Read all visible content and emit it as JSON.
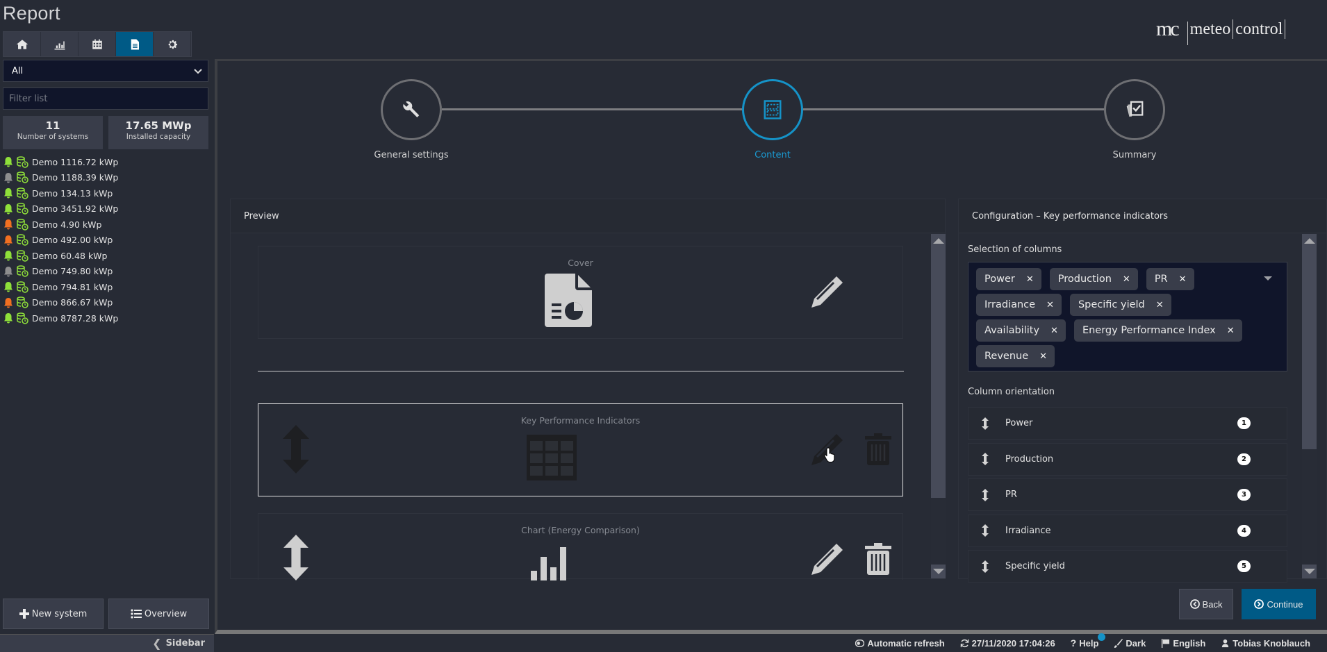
{
  "app": {
    "title": "Report"
  },
  "logo": {
    "mark": "mc",
    "word1": "meteo",
    "word2": "control"
  },
  "nav_tabs": [
    {
      "name": "home",
      "icon": "home-icon",
      "active": false
    },
    {
      "name": "analysis",
      "icon": "bar-chart-icon",
      "active": false
    },
    {
      "name": "calendar",
      "icon": "calendar-icon",
      "active": false
    },
    {
      "name": "report",
      "icon": "document-icon",
      "active": true
    },
    {
      "name": "settings",
      "icon": "gear-icon",
      "active": false
    }
  ],
  "sidebar": {
    "group_select": {
      "value": "All"
    },
    "filter": {
      "placeholder": "Filter list",
      "value": ""
    },
    "stats": [
      {
        "value": "11",
        "label": "Number of systems"
      },
      {
        "value": "17.65 MWp",
        "label": "Installed capacity"
      }
    ],
    "systems": [
      {
        "name": "Demo 1116.72 kWp",
        "alarm": "green"
      },
      {
        "name": "Demo 1188.39 kWp",
        "alarm": "gray"
      },
      {
        "name": "Demo 134.13 kWp",
        "alarm": "green"
      },
      {
        "name": "Demo 3451.92 kWp",
        "alarm": "green"
      },
      {
        "name": "Demo 4.90 kWp",
        "alarm": "orange"
      },
      {
        "name": "Demo 492.00 kWp",
        "alarm": "orange"
      },
      {
        "name": "Demo 60.48 kWp",
        "alarm": "green"
      },
      {
        "name": "Demo 749.80 kWp",
        "alarm": "gray"
      },
      {
        "name": "Demo 794.81 kWp",
        "alarm": "green"
      },
      {
        "name": "Demo 866.67 kWp",
        "alarm": "orange"
      },
      {
        "name": "Demo 8787.28 kWp",
        "alarm": "green"
      }
    ],
    "new_system_label": "New system",
    "overview_label": "Overview",
    "toggle_label": "Sidebar"
  },
  "colors": {
    "accent": "#1593c8",
    "primary_button": "#005a86",
    "alarm_green": "#8fe03a",
    "alarm_orange": "#f26f21",
    "alarm_gray": "#8e8e8e",
    "db_icon": "#8fe03a"
  },
  "wizard": {
    "steps": [
      {
        "label": "General settings",
        "icon": "wrench-icon",
        "state": "done"
      },
      {
        "label": "Content",
        "icon": "layout-icon",
        "state": "active"
      },
      {
        "label": "Summary",
        "icon": "checklist-icon",
        "state": "pending"
      }
    ]
  },
  "preview": {
    "title": "Preview",
    "cards": [
      {
        "title": "Cover",
        "icon": "file-chart-icon",
        "editable": true,
        "deletable": false,
        "movable": false,
        "selected": false
      },
      {
        "title": "Key Performance Indicators",
        "icon": "table-icon",
        "editable": true,
        "deletable": true,
        "movable": true,
        "selected": true
      },
      {
        "title": "Chart (Energy Comparison)",
        "icon": "bar-chart-icon",
        "editable": true,
        "deletable": true,
        "movable": true,
        "selected": false
      }
    ]
  },
  "config": {
    "title": "Configuration – Key performance indicators",
    "selection_label": "Selection of columns",
    "selected_columns": [
      "Power",
      "Production",
      "PR",
      "Irradiance",
      "Specific yield",
      "Availability",
      "Energy Performance Index",
      "Revenue"
    ],
    "orientation_label": "Column orientation",
    "orientation": [
      {
        "label": "Power",
        "order": "1"
      },
      {
        "label": "Production",
        "order": "2"
      },
      {
        "label": "PR",
        "order": "3"
      },
      {
        "label": "Irradiance",
        "order": "4"
      },
      {
        "label": "Specific yield",
        "order": "5"
      }
    ]
  },
  "actions": {
    "back_label": "Back",
    "continue_label": "Continue"
  },
  "footer": {
    "auto_refresh": "Automatic refresh",
    "timestamp": "27/11/2020 17:04:26",
    "help": "Help",
    "theme": "Dark",
    "language": "English",
    "user": "Tobias Knoblauch"
  }
}
